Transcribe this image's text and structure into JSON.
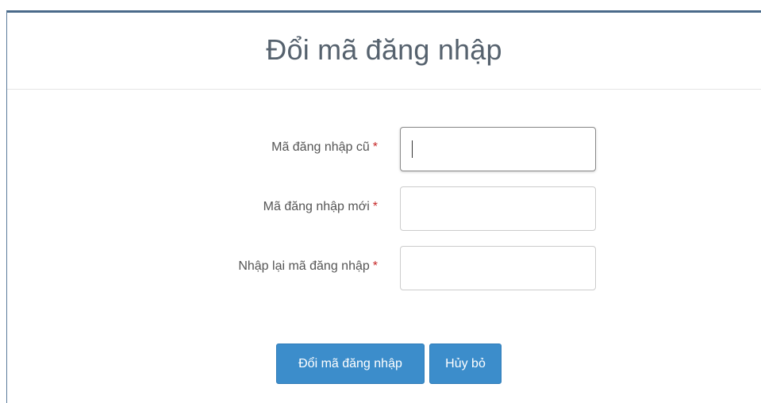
{
  "page": {
    "title": "Đổi mã đăng nhập"
  },
  "form": {
    "required_mark": "*",
    "fields": [
      {
        "label": "Mã đăng nhập cũ",
        "value": "",
        "focused": true
      },
      {
        "label": "Mã đăng nhập mới",
        "value": "",
        "focused": false
      },
      {
        "label": "Nhập lại mã đăng nhập",
        "value": "",
        "focused": false
      }
    ]
  },
  "actions": {
    "submit_label": "Đổi mã đăng nhập",
    "cancel_label": "Hủy bỏ"
  },
  "colors": {
    "button_bg": "#3c8dcb",
    "required_mark": "#c62828",
    "title_text": "#56626e"
  }
}
